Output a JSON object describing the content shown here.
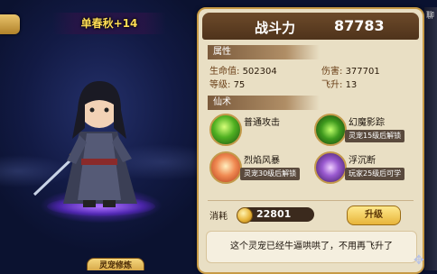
{
  "pet": {
    "name_level": "单春秋+14",
    "bottom_button": "灵宠修炼"
  },
  "panel": {
    "power_label": "战斗力",
    "power_value": "87783",
    "side_tab": "聊"
  },
  "attributes": {
    "header": "属性",
    "hp_label": "生命值:",
    "hp_value": "502304",
    "damage_label": "伤害:",
    "damage_value": "377701",
    "level_label": "等级:",
    "level_value": "75",
    "ascend_label": "飞升:",
    "ascend_value": "13"
  },
  "skills": {
    "header": "仙术",
    "items": [
      {
        "name": "普通攻击",
        "desc": "",
        "icon": "green-whirl-icon",
        "color": "#2e8a1e"
      },
      {
        "name": "幻魔影踪",
        "desc": "灵宠15级后解锁",
        "icon": "green-slash-icon",
        "color": "#2a7f22"
      },
      {
        "name": "烈焰风暴",
        "desc": "灵宠30级后解锁",
        "icon": "flame-storm-icon",
        "color": "#d8642b"
      },
      {
        "name": "浮沉断",
        "desc": "玩家25级后可学",
        "icon": "purple-vortex-icon",
        "color": "#6a3fa0"
      }
    ]
  },
  "cost": {
    "label": "消耗",
    "value": "22801",
    "upgrade_button": "升级"
  },
  "message": "这个灵宠已经牛逼哄哄了，不用再飞升了",
  "colors": {
    "accent_gold": "#ffdd55",
    "panel_bg": "#e9dfc4",
    "power_bar": "#5a3a20"
  }
}
